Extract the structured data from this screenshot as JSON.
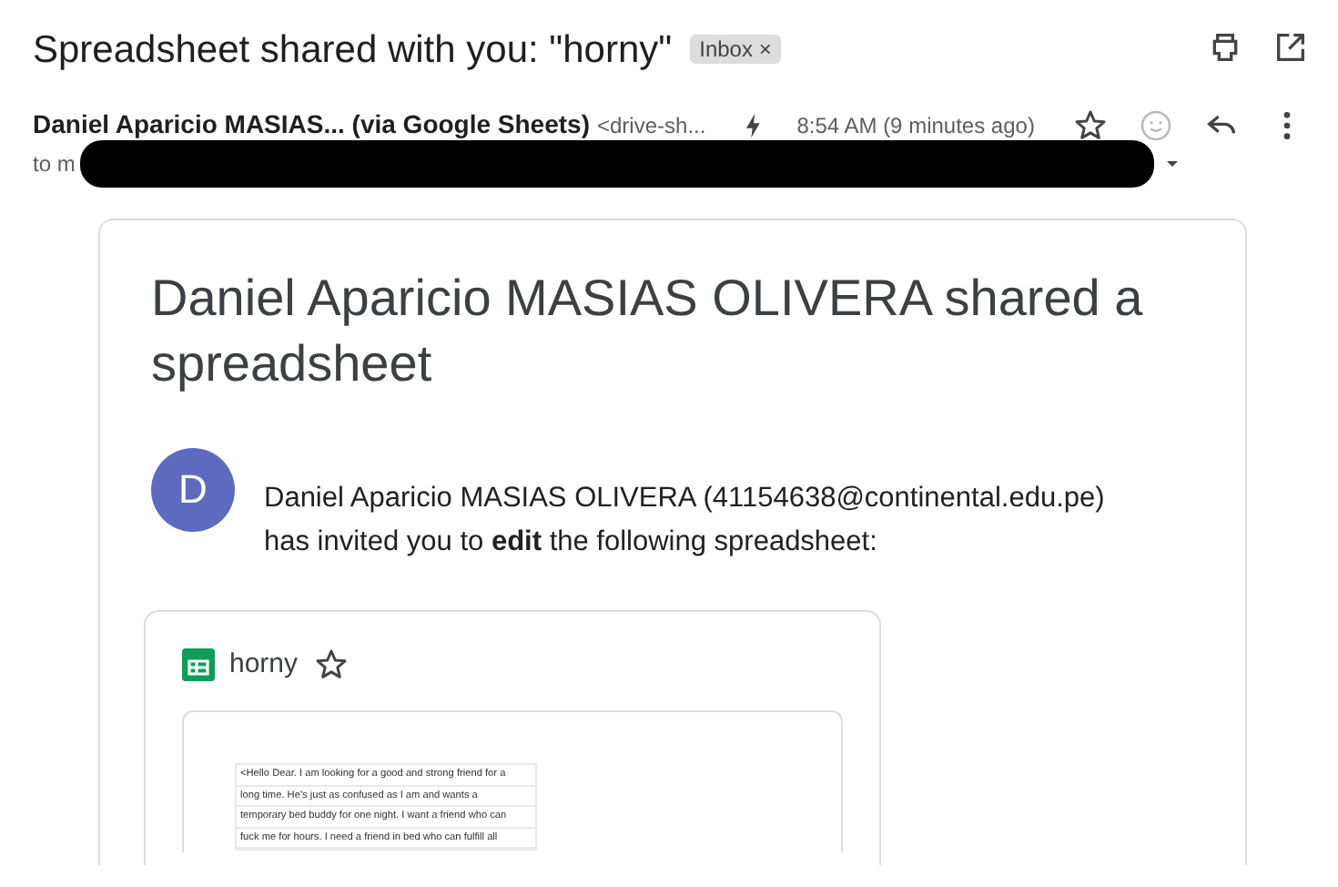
{
  "subject": "Spreadsheet shared with you: \"horny\"",
  "label": {
    "text": "Inbox",
    "close": "×"
  },
  "sender": {
    "name": "Daniel Aparicio MASIAS... (via Google Sheets)",
    "address": "<drive-sh...",
    "time": "8:54 AM (9 minutes ago)",
    "starred": false,
    "to": "to m"
  },
  "heading": "Daniel Aparicio MASIAS OLIVERA shared a spreadsheet",
  "avatar": {
    "letter": "D",
    "color": "#5c6bc0"
  },
  "invite": "Daniel Aparicio MASIAS OLIVERA (41154638@continental.edu.pe) has invited you to **edit** the following spreadsheet:",
  "file": {
    "name": "horny",
    "starred": false
  },
  "preview_lines": [
    "<Hello Dear. I am looking for a good and strong friend for a",
    "long time. He's just as confused as I am and wants a",
    "temporary bed buddy for one night. I want a friend who can",
    "fuck me for hours. I need a friend in bed who can fulfill all"
  ]
}
